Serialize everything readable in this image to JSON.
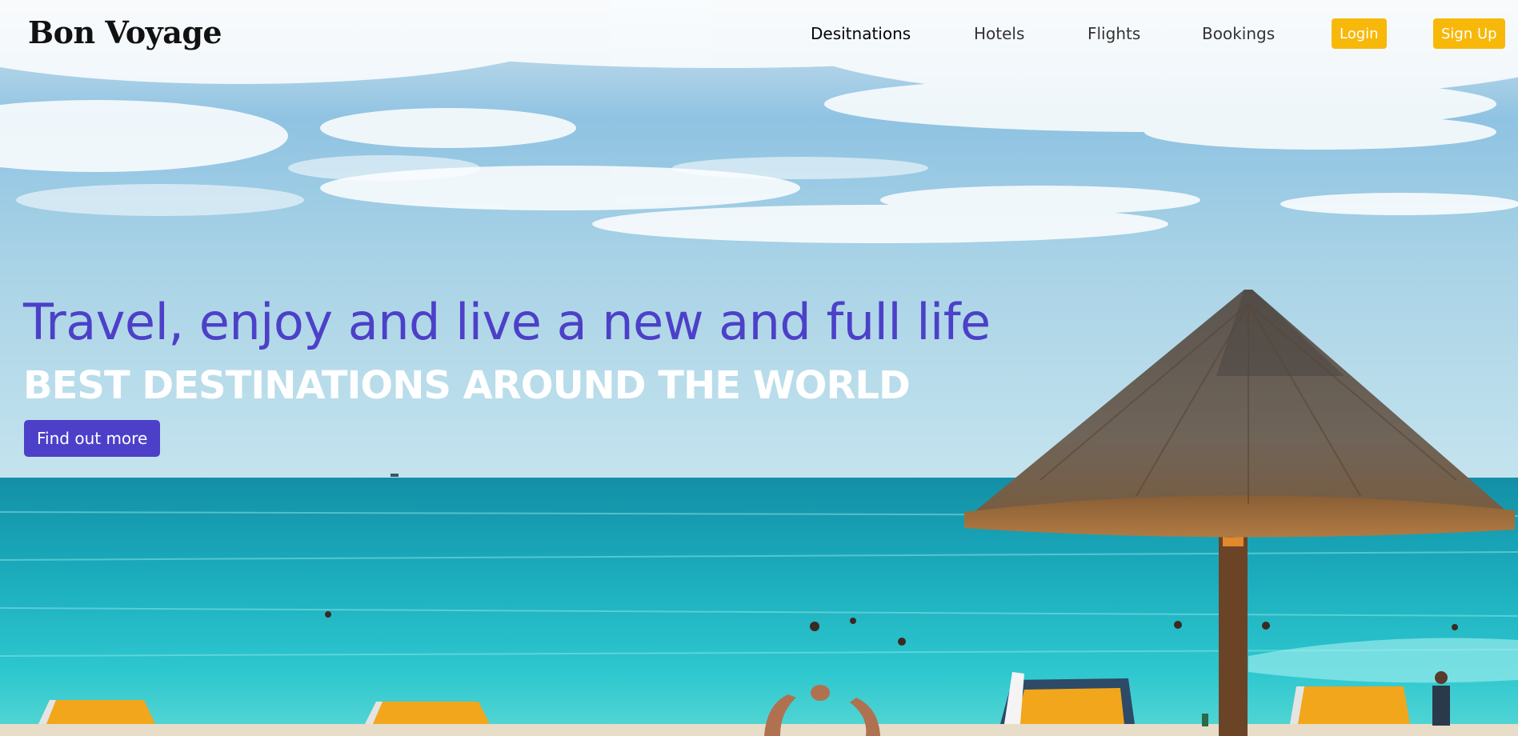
{
  "brand": {
    "logo": "Bon Voyage"
  },
  "nav": {
    "links": [
      {
        "label": "Desitnations",
        "active": true
      },
      {
        "label": "Hotels"
      },
      {
        "label": "Flights"
      },
      {
        "label": "Bookings"
      }
    ],
    "login_label": "Login",
    "signup_label": "Sign Up"
  },
  "hero": {
    "title": "Travel, enjoy and live a new and full life",
    "subtitle": "BEST DESTINATIONS AROUND THE WORLD",
    "cta_label": "Find out more",
    "background_scene": "tropical beach with thatched umbrella, turquoise sea, sunbeds and swimmers"
  },
  "colors": {
    "accent": "#4d40c8",
    "button_yellow": "#f7b80a",
    "logo_text": "#111111",
    "sea": "#1fb6c5",
    "sky": "#9ccde4"
  }
}
